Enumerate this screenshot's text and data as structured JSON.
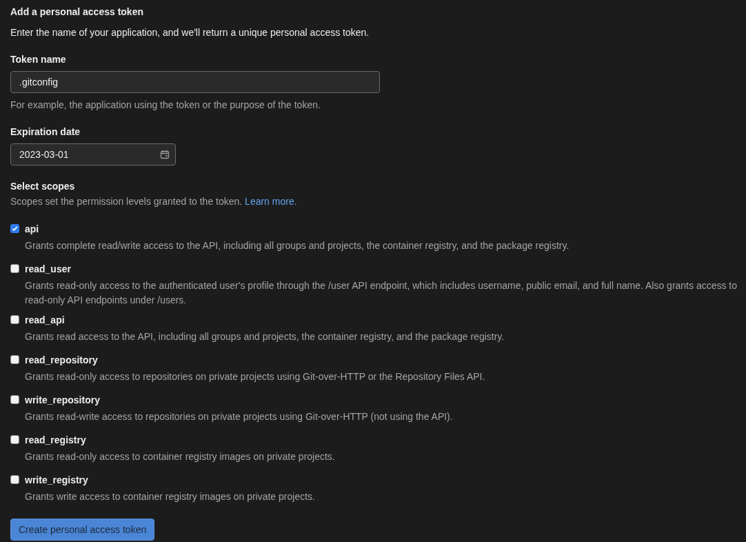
{
  "heading": "Add a personal access token",
  "intro": "Enter the name of your application, and we'll return a unique personal access token.",
  "token_name": {
    "label": "Token name",
    "value": ".gitconfig",
    "help": "For example, the application using the token or the purpose of the token."
  },
  "expiration": {
    "label": "Expiration date",
    "value": "2023-03-01"
  },
  "scopes_section": {
    "label": "Select scopes",
    "description": "Scopes set the permission levels granted to the token.",
    "link": "Learn more."
  },
  "scopes": [
    {
      "name": "api",
      "checked": true,
      "description": "Grants complete read/write access to the API, including all groups and projects, the container registry, and the package registry."
    },
    {
      "name": "read_user",
      "checked": false,
      "description": "Grants read-only access to the authenticated user's profile through the /user API endpoint, which includes username, public email, and full name. Also grants access to read-only API endpoints under /users."
    },
    {
      "name": "read_api",
      "checked": false,
      "description": "Grants read access to the API, including all groups and projects, the container registry, and the package registry."
    },
    {
      "name": "read_repository",
      "checked": false,
      "description": "Grants read-only access to repositories on private projects using Git-over-HTTP or the Repository Files API."
    },
    {
      "name": "write_repository",
      "checked": false,
      "description": "Grants read-write access to repositories on private projects using Git-over-HTTP (not using the API)."
    },
    {
      "name": "read_registry",
      "checked": false,
      "description": "Grants read-only access to container registry images on private projects."
    },
    {
      "name": "write_registry",
      "checked": false,
      "description": "Grants write access to container registry images on private projects."
    }
  ],
  "submit": "Create personal access token"
}
